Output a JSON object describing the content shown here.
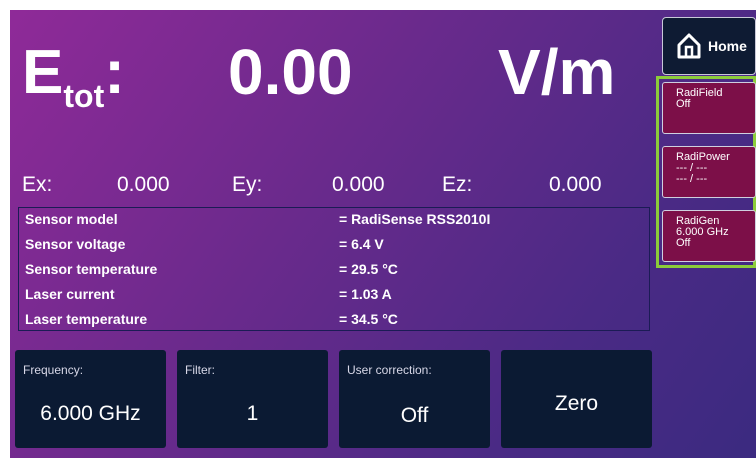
{
  "readout": {
    "label_main": "E",
    "label_sub": "tot",
    "label_colon": ":",
    "value": "0.00",
    "unit": "V/m"
  },
  "components": {
    "ex_label": "Ex:",
    "ex_value": "0.000",
    "ey_label": "Ey:",
    "ey_value": "0.000",
    "ez_label": "Ez:",
    "ez_value": "0.000"
  },
  "info": [
    {
      "key": "Sensor model",
      "value": "= RadiSense RSS2010I"
    },
    {
      "key": "Sensor voltage",
      "value": "= 6.4 V"
    },
    {
      "key": "Sensor temperature",
      "value": "= 29.5 °C"
    },
    {
      "key": "Laser current",
      "value": "= 1.03 A"
    },
    {
      "key": "Laser temperature",
      "value": "= 34.5  °C"
    }
  ],
  "buttons": {
    "frequency": {
      "caption": "Frequency:",
      "value": "6.000 GHz"
    },
    "filter": {
      "caption": "Filter:",
      "value": "1"
    },
    "user_correction": {
      "caption": "User correction:",
      "value": "Off"
    },
    "zero": {
      "value": "Zero"
    }
  },
  "side": {
    "home_label": "Home",
    "radifield": {
      "line1": "RadiField",
      "line2": "Off"
    },
    "radipower": {
      "line1": "RadiPower",
      "line2": "--- / ---",
      "line3": "--- / ---"
    },
    "radigen": {
      "line1": "RadiGen",
      "line2": "6.000 GHz",
      "line3": "Off"
    }
  },
  "colors": {
    "background_start": "#8f2a98",
    "background_end": "#3b2a80",
    "button_bg": "#0b1a33",
    "side_button_bg": "#7c0f48",
    "highlight_frame": "#8ccc3a"
  }
}
